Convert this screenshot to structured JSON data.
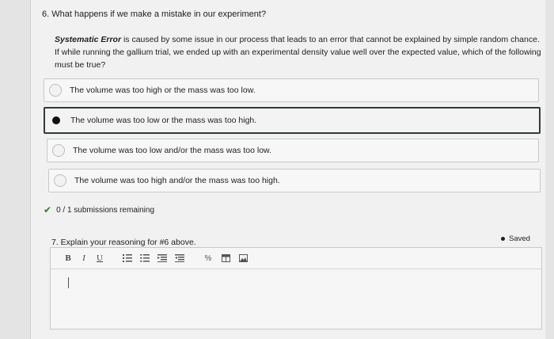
{
  "question6": {
    "title": "6. What happens if we make a mistake in our experiment?",
    "prompt_term": "Systematic Error",
    "prompt_text": " is caused by some issue in our process that leads to an error that cannot be explained by simple random chance. If while running the gallium trial, we ended up with an experimental density value well over the expected value, which of the following must be true?",
    "options": [
      {
        "label": "The volume was too high or the mass was too low.",
        "selected": false
      },
      {
        "label": "The volume was too low or the mass was too high.",
        "selected": true
      },
      {
        "label": "The volume was too low and/or the mass was too low.",
        "selected": false
      },
      {
        "label": "The volume was too high and/or the mass was too high.",
        "selected": false
      }
    ],
    "status": "0 / 1 submissions remaining"
  },
  "question7": {
    "title": "7. Explain your reasoning for #6 above.",
    "saved_label": "Saved",
    "toolbar": {
      "bold": "B",
      "italic": "I",
      "underline": "U"
    }
  }
}
